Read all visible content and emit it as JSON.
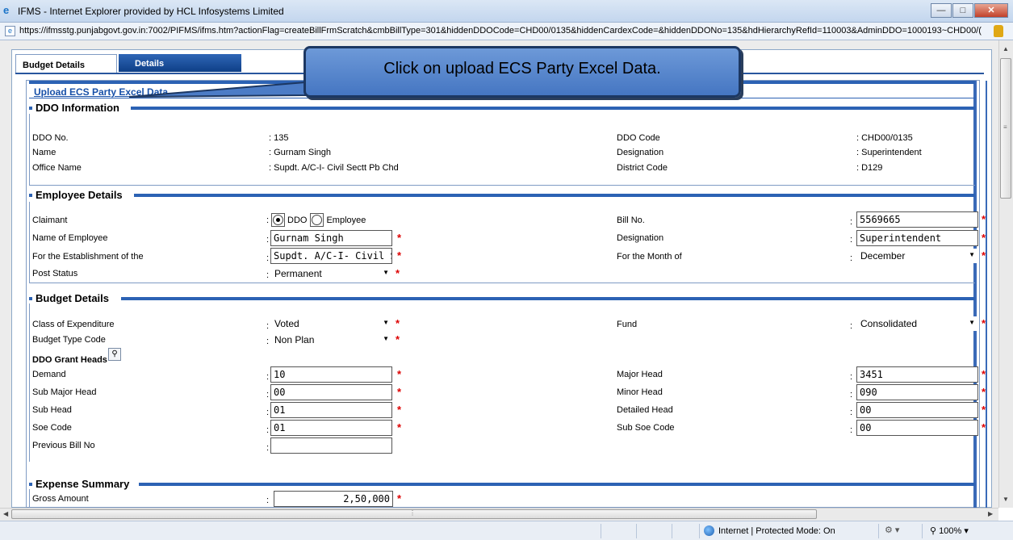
{
  "window": {
    "title": "IFMS - Internet Explorer provided by HCL Infosystems Limited",
    "url": "https://ifmsstg.punjabgovt.gov.in:7002/PIFMS/ifms.htm?actionFlag=createBillFrmScratch&cmbBillType=301&hiddenDDOCode=CHD00/0135&hiddenCardexCode=&hiddenDDONo=135&hdHierarchyRefId=110003&AdminDDO=1000193~CHD00/("
  },
  "tabs": [
    "Budget Details",
    "Details"
  ],
  "upload_link": "Upload ECS Party Excel Data",
  "callout": "Click on upload ECS Party Excel Data.",
  "ddo": {
    "heading": "DDO Information",
    "rows": [
      {
        "label": "DDO No.",
        "value": ": 135",
        "label2": "DDO Code",
        "value2": ": CHD00/0135"
      },
      {
        "label": "Name",
        "value": ": Gurnam Singh",
        "label2": "Designation",
        "value2": ": Superintendent"
      },
      {
        "label": "Office Name",
        "value": ": Supdt. A/C-I- Civil Sectt Pb Chd",
        "label2": "District Code",
        "value2": ": D129"
      }
    ]
  },
  "employee": {
    "heading": "Employee Details",
    "claimant_label": "Claimant",
    "claimant_options": [
      "DDO",
      "Employee"
    ],
    "claimant_selected": "DDO",
    "name_label": "Name of Employee",
    "name_value": "Gurnam   Singh",
    "estab_label": "For the Establishment of the",
    "estab_value": "Supdt. A/C-I- Civil Sectt",
    "post_label": "Post Status",
    "post_value": "Permanent",
    "bill_label": "Bill No.",
    "bill_value": "5569665",
    "desig_label": "Designation",
    "desig_value": "Superintendent",
    "month_label": "For the Month of",
    "month_value": "December"
  },
  "budget": {
    "heading": "Budget Details",
    "class_label": "Class of Expenditure",
    "class_value": "Voted",
    "type_label": "Budget Type Code",
    "type_value": "Non Plan",
    "fund_label": "Fund",
    "fund_value": "Consolidated",
    "grant_label": "DDO Grant Heads",
    "demand_label": "Demand",
    "demand_value": "10",
    "submajor_label": "Sub Major Head",
    "submajor_value": "00",
    "subhead_label": "Sub Head",
    "subhead_value": "01",
    "soe_label": "Soe Code",
    "soe_value": "01",
    "prevbill_label": "Previous Bill No",
    "prevbill_value": "",
    "major_label": "Major Head",
    "major_value": "3451",
    "minor_label": "Minor Head",
    "minor_value": "090",
    "detailed_label": "Detailed Head",
    "detailed_value": "00",
    "subsoe_label": "Sub Soe Code",
    "subsoe_value": "00"
  },
  "expense": {
    "heading": "Expense Summary",
    "gross_label": "Gross Amount",
    "gross_value": "2,50,000"
  },
  "status": {
    "zone": "Internet | Protected Mode: On",
    "zoom": "100%"
  }
}
